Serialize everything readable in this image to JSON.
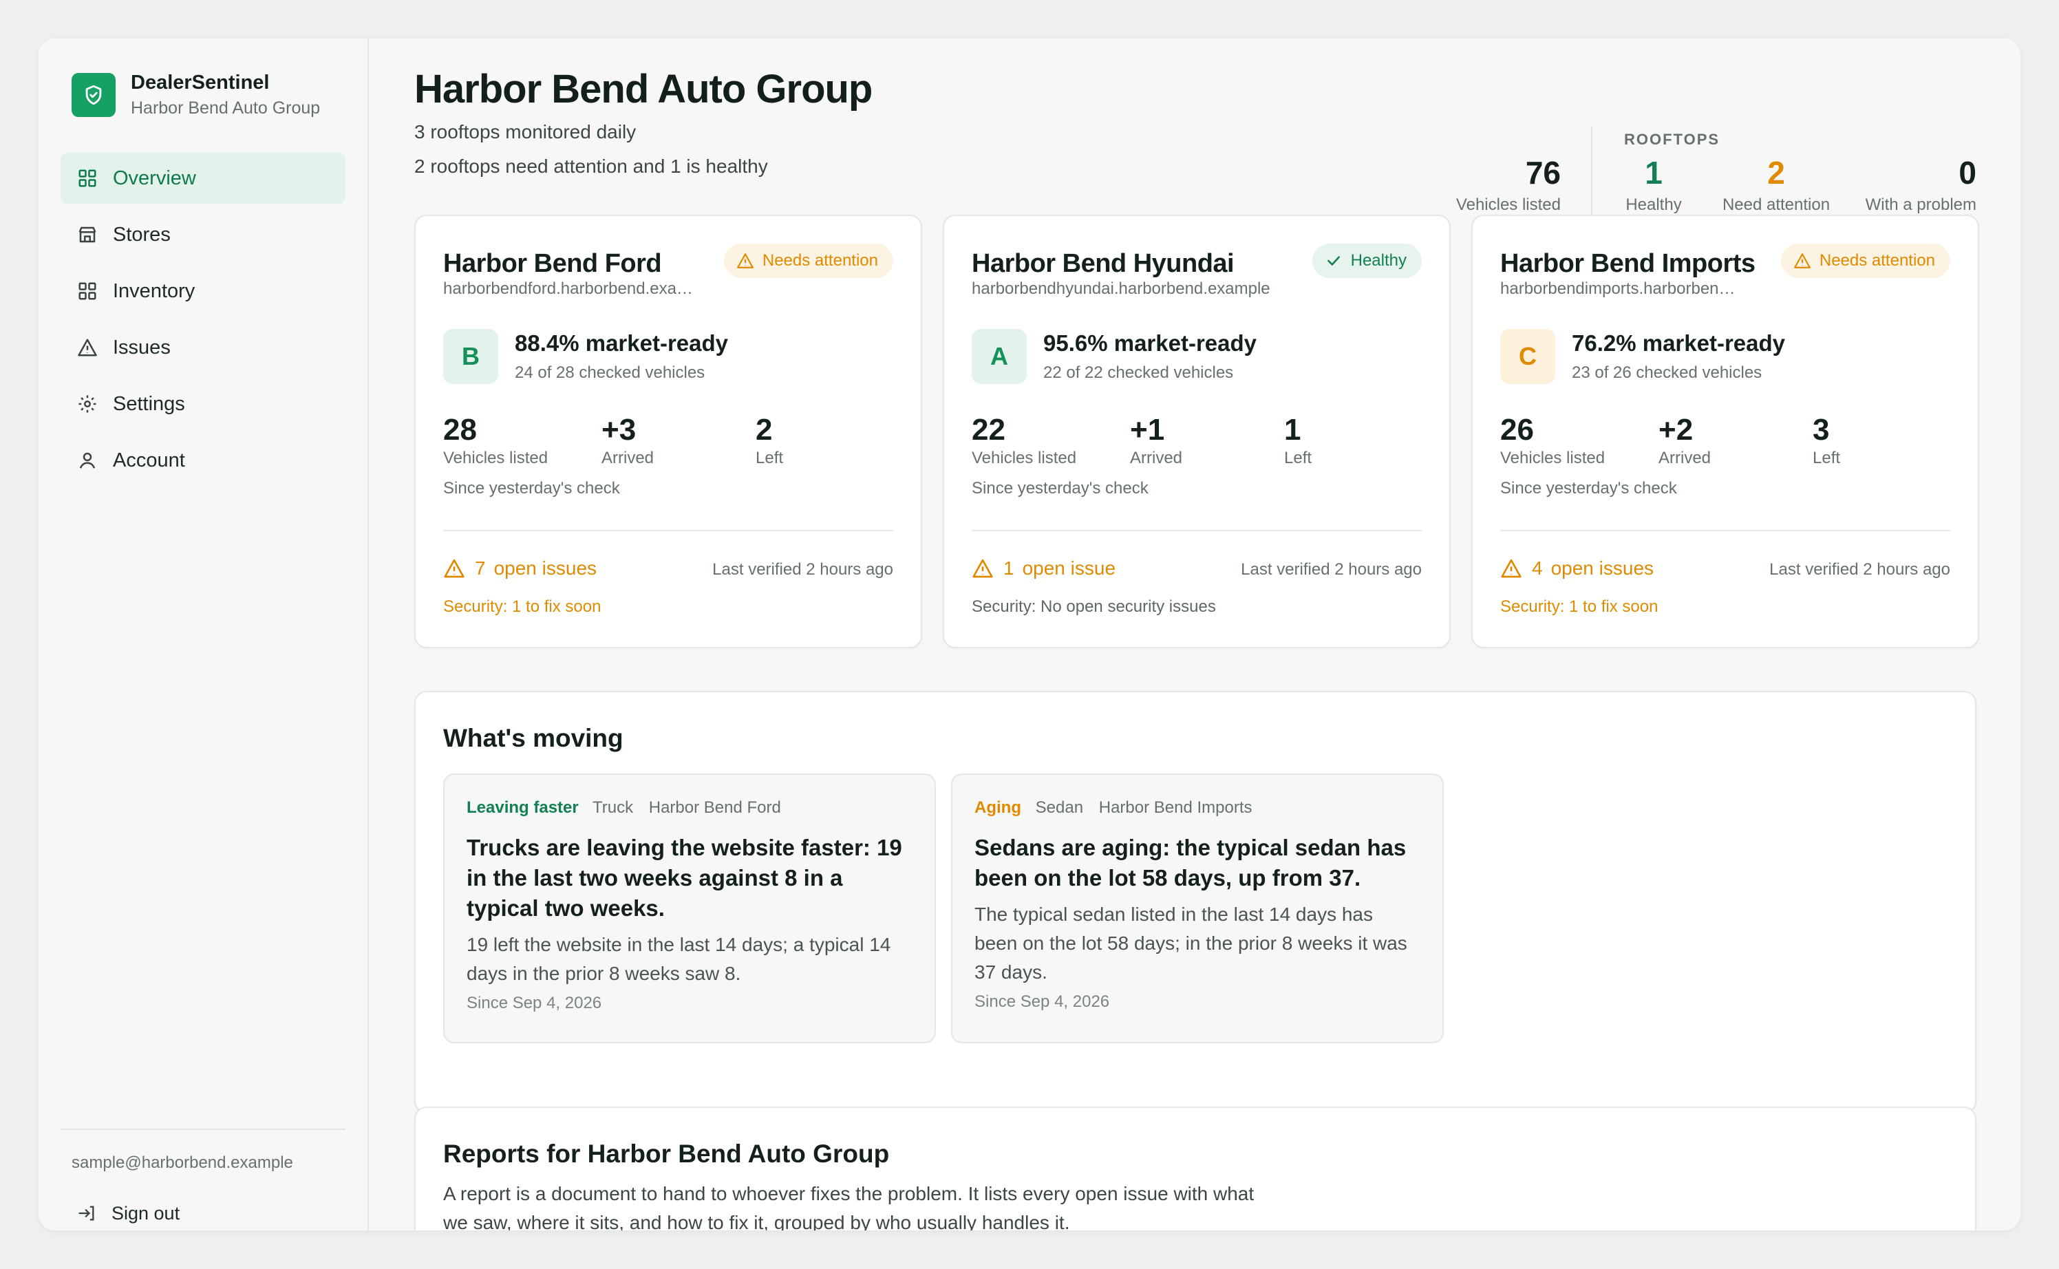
{
  "brand": {
    "name": "DealerSentinel",
    "sub": "Harbor Bend Auto Group"
  },
  "nav": [
    {
      "label": "Overview",
      "icon": "grid-icon",
      "active": true
    },
    {
      "label": "Stores",
      "icon": "store-icon"
    },
    {
      "label": "Inventory",
      "icon": "grid-icon"
    },
    {
      "label": "Issues",
      "icon": "warning-icon"
    },
    {
      "label": "Settings",
      "icon": "gear-icon"
    },
    {
      "label": "Account",
      "icon": "user-icon"
    }
  ],
  "footer": {
    "email": "sample@harborbend.example",
    "signout": "Sign out"
  },
  "header": {
    "title": "Harbor Bend Auto Group",
    "sub1": "3 rooftops monitored daily",
    "sub2": "2 rooftops need attention and 1 is healthy"
  },
  "stats": {
    "vehicles": {
      "num": "76",
      "label": "Vehicles listed"
    },
    "rooftops_label": "ROOFTOPS",
    "healthy": {
      "num": "1",
      "label": "Healthy"
    },
    "attention": {
      "num": "2",
      "label": "Need attention"
    },
    "problem": {
      "num": "0",
      "label": "With a problem"
    }
  },
  "colors": {
    "green": "#128052",
    "amber": "#e08a00"
  },
  "stores": [
    {
      "name": "Harbor Bend Ford",
      "url": "harborbendford.harborbend.example",
      "status": "Needs attention",
      "grade": "B",
      "ready": "88.4% market-ready",
      "checked": "24 of 28 checked vehicles",
      "listed": "28",
      "listed_label": "Vehicles listed",
      "arrived": "+3",
      "arrived_label": "Arrived",
      "left": "2",
      "left_label": "Left",
      "since": "Since yesterday's check",
      "issues_count": "7",
      "issues_label": "open issues",
      "verified": "Last verified 2 hours ago",
      "security": "Security: 1 to fix soon"
    },
    {
      "name": "Harbor Bend Hyundai",
      "url": "harborbendhyundai.harborbend.example",
      "status": "Healthy",
      "grade": "A",
      "ready": "95.6% market-ready",
      "checked": "22 of 22 checked vehicles",
      "listed": "22",
      "listed_label": "Vehicles listed",
      "arrived": "+1",
      "arrived_label": "Arrived",
      "left": "1",
      "left_label": "Left",
      "since": "Since yesterday's check",
      "issues_count": "1",
      "issues_label": "open issue",
      "verified": "Last verified 2 hours ago",
      "security": "Security: No open security issues"
    },
    {
      "name": "Harbor Bend Imports",
      "url": "harborbendimports.harborbend.example",
      "status": "Needs attention",
      "grade": "C",
      "ready": "76.2% market-ready",
      "checked": "23 of 26 checked vehicles",
      "listed": "26",
      "listed_label": "Vehicles listed",
      "arrived": "+2",
      "arrived_label": "Arrived",
      "left": "3",
      "left_label": "Left",
      "since": "Since yesterday's check",
      "issues_count": "4",
      "issues_label": "open issues",
      "verified": "Last verified 2 hours ago",
      "security": "Security: 1 to fix soon"
    }
  ],
  "moving": {
    "title": "What's moving",
    "cards": [
      {
        "tag": "Leaving faster",
        "type": "Truck",
        "store": "Harbor Bend Ford",
        "title": "Trucks are leaving the website faster: 19 in the last two weeks against 8 in a typical two weeks.",
        "body": "19 left the website in the last 14 days; a typical 14 days in the prior 8 weeks saw 8.",
        "since": "Since Sep 4, 2026"
      },
      {
        "tag": "Aging",
        "type": "Sedan",
        "store": "Harbor Bend Imports",
        "title": "Sedans are aging: the typical sedan has been on the lot 58 days, up from 37.",
        "body": "The typical sedan listed in the last 14 days has been on the lot 58 days; in the prior 8 weeks it was 37 days.",
        "since": "Since Sep 4, 2026"
      }
    ]
  },
  "reports": {
    "title": "Reports for Harbor Bend Auto Group",
    "body": "A report is a document to hand to whoever fixes the problem. It lists every open issue with what we saw, where it sits, and how to fix it, grouped by who usually handles it."
  }
}
